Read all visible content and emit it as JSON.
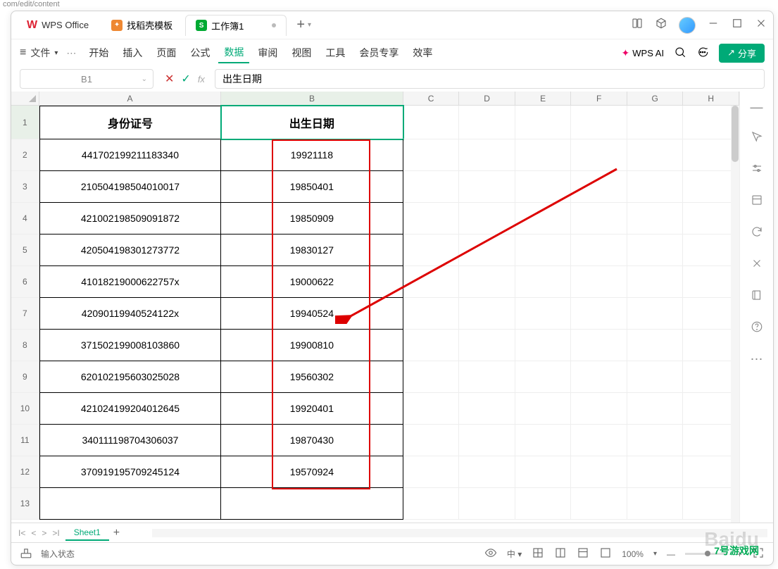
{
  "browser_addr": "com/edit/content",
  "tabs": {
    "wps": "WPS Office",
    "daoke": "找稻壳模板",
    "workbook": "工作簿1"
  },
  "menu": {
    "file": "文件",
    "items": [
      "开始",
      "插入",
      "页面",
      "公式",
      "数据",
      "审阅",
      "视图",
      "工具",
      "会员专享",
      "效率"
    ],
    "active_index": 4,
    "wps_ai": "WPS AI",
    "share": "分享"
  },
  "formula_bar": {
    "name_box": "B1",
    "formula": "出生日期"
  },
  "columns": [
    "A",
    "B",
    "C",
    "D",
    "E",
    "F",
    "G",
    "H"
  ],
  "rows": [
    {
      "n": "1",
      "a": "身份证号",
      "b": "出生日期",
      "header": true
    },
    {
      "n": "2",
      "a": "441702199211183340",
      "b": "19921118"
    },
    {
      "n": "3",
      "a": "210504198504010017",
      "b": "19850401"
    },
    {
      "n": "4",
      "a": "421002198509091872",
      "b": "19850909"
    },
    {
      "n": "5",
      "a": "420504198301273772",
      "b": "19830127"
    },
    {
      "n": "6",
      "a": "41018219000622757x",
      "b": "19000622"
    },
    {
      "n": "7",
      "a": "42090119940524122x",
      "b": "19940524"
    },
    {
      "n": "8",
      "a": "371502199008103860",
      "b": "19900810"
    },
    {
      "n": "9",
      "a": "620102195603025028",
      "b": "19560302"
    },
    {
      "n": "10",
      "a": "421024199204012645",
      "b": "19920401"
    },
    {
      "n": "11",
      "a": "340111198704306037",
      "b": "19870430"
    },
    {
      "n": "12",
      "a": "370919195709245124",
      "b": "19570924"
    },
    {
      "n": "13",
      "a": "",
      "b": ""
    }
  ],
  "sheet_tab": "Sheet1",
  "status": {
    "input_mode": "输入状态",
    "zoom": "100%"
  }
}
